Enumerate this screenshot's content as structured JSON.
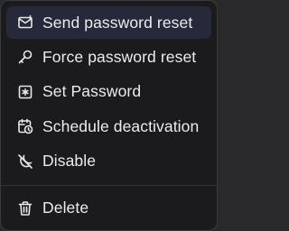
{
  "menu": {
    "items": [
      {
        "label": "Send password reset",
        "icon": "mail-icon",
        "active": true
      },
      {
        "label": "Force password reset",
        "icon": "key-icon",
        "active": false
      },
      {
        "label": "Set Password",
        "icon": "asterisk-icon",
        "active": false
      },
      {
        "label": "Schedule deactivation",
        "icon": "calendar-clock-icon",
        "active": false
      },
      {
        "label": "Disable",
        "icon": "moon-off-icon",
        "active": false
      }
    ],
    "delete": {
      "label": "Delete",
      "icon": "trash-icon"
    },
    "colors": {
      "background": "#1b1b1d",
      "active_background": "#25293a",
      "text": "#ececee",
      "border": "#3a3a3d"
    }
  }
}
